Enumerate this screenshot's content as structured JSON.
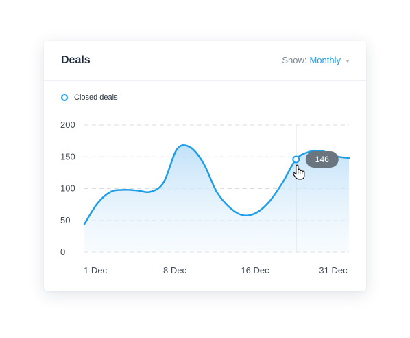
{
  "card": {
    "title": "Deals",
    "show_label": "Show:",
    "show_value": "Monthly"
  },
  "legend": {
    "label": "Closed deals"
  },
  "colors": {
    "accent": "#1f9ee8",
    "tooltip_bg": "#6b7580",
    "grid": "#d9dde2"
  },
  "chart_data": {
    "type": "area",
    "x_ticks": [
      "1 Dec",
      "8 Dec",
      "16 Dec",
      "31 Dec"
    ],
    "y_ticks": [
      200,
      150,
      100,
      50,
      0
    ],
    "ylim": [
      0,
      200
    ],
    "series": [
      {
        "name": "Closed deals",
        "values": [
          44,
          77,
          95,
          98,
          97,
          95,
          110,
          162,
          165,
          140,
          95,
          70,
          58,
          62,
          80,
          110,
          146,
          158,
          159,
          151,
          148
        ]
      }
    ],
    "highlight": {
      "index": 16,
      "value": "146"
    },
    "grid": true
  }
}
